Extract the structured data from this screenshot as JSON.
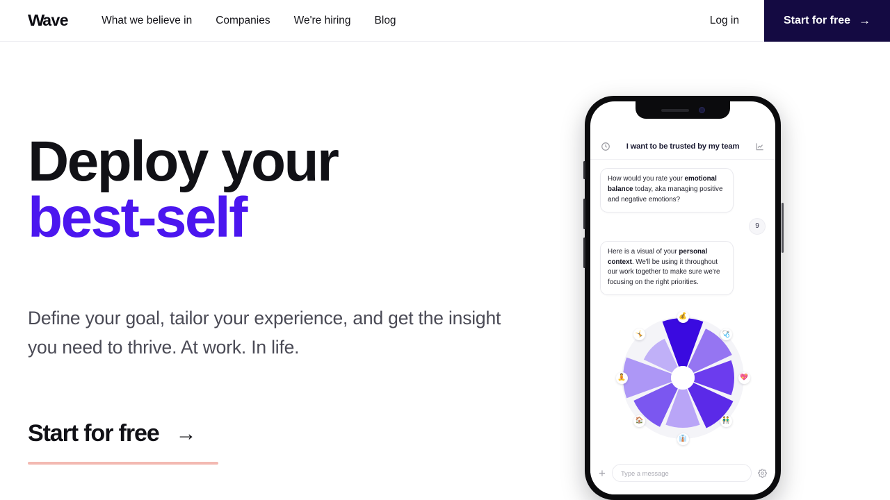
{
  "header": {
    "logo": "Wave",
    "logo_w": "W",
    "logo_rest": "ave",
    "nav": [
      {
        "label": "What we believe in"
      },
      {
        "label": "Companies"
      },
      {
        "label": "We're hiring"
      },
      {
        "label": "Blog"
      }
    ],
    "login_label": "Log in",
    "cta_label": "Start for free",
    "cta_arrow": "→",
    "cta_bg": "#140a42"
  },
  "hero": {
    "title_line1": "Deploy your",
    "title_line2": "best-self",
    "accent_color": "#4b16ef",
    "subtitle": "Define your goal, tailor your experience, and get the insight you need to thrive. At work. In life.",
    "cta_label": "Start for free",
    "cta_arrow": "→",
    "cta_underline_color": "#f3b9b2"
  },
  "phone": {
    "screen_header": {
      "title": "I want to be trusted by my team",
      "left_icon": "clock-icon",
      "right_icon": "chart-line-icon"
    },
    "messages": [
      {
        "from": "assistant",
        "parts": [
          {
            "text": "How would you rate your ",
            "bold": false
          },
          {
            "text": "emotional balance",
            "bold": true
          },
          {
            "text": " today, aka managing positive and negative emotions?",
            "bold": false
          }
        ]
      },
      {
        "from": "user",
        "value": "9"
      },
      {
        "from": "assistant",
        "parts": [
          {
            "text": "Here is a visual of your ",
            "bold": false
          },
          {
            "text": "personal context",
            "bold": true
          },
          {
            "text": ". We'll be using it throughout our work together to make sure we're focusing on the right priorities.",
            "bold": false
          }
        ]
      }
    ],
    "input": {
      "placeholder": "Type a message",
      "value": "",
      "add_icon": "plus-icon",
      "settings_icon": "gear-icon"
    }
  },
  "chart_data": {
    "type": "pie",
    "title": "personal context wheel",
    "categories": [
      "finances",
      "health",
      "love",
      "friends-family",
      "career",
      "home",
      "personal-growth",
      "fun-recreation"
    ],
    "values": [
      12.5,
      12.5,
      12.5,
      12.5,
      12.5,
      12.5,
      12.5,
      12.5
    ],
    "radii": [
      86,
      78,
      74,
      80,
      72,
      78,
      86,
      62
    ],
    "colors": [
      "#3a0ae0",
      "#9575f2",
      "#6c3cee",
      "#5b2ae8",
      "#b9a5f7",
      "#7b57f0",
      "#ad97f6",
      "#c0b0f8"
    ],
    "emojis": [
      "💰",
      "🩺",
      "💖",
      "👬",
      "👔",
      "🏠",
      "🧘",
      "🤸"
    ],
    "legend_position": "around",
    "grid": false
  }
}
